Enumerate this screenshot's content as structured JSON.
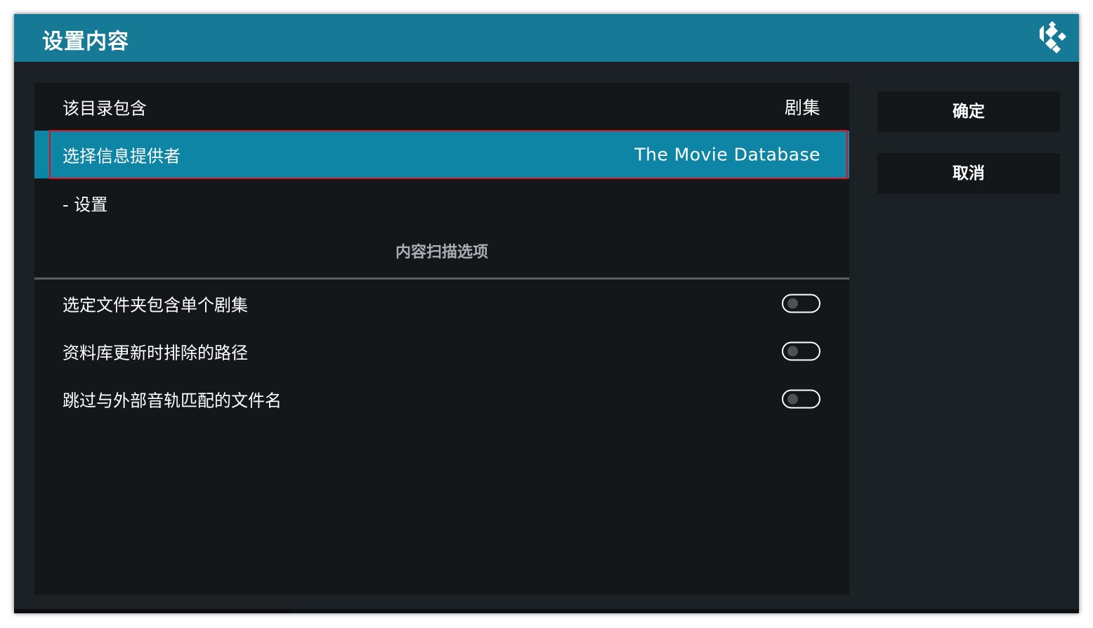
{
  "dialog": {
    "title": "设置内容"
  },
  "rows": {
    "contains": {
      "label": "该目录包含",
      "value": "剧集"
    },
    "provider": {
      "label": "选择信息提供者",
      "value": "The Movie Database"
    },
    "settings": {
      "label": "- 设置"
    }
  },
  "section": {
    "title": "内容扫描选项"
  },
  "options": [
    {
      "label": "选定文件夹包含单个剧集",
      "enabled": false
    },
    {
      "label": "资料库更新时排除的路径",
      "enabled": false
    },
    {
      "label": "跳过与外部音轨匹配的文件名",
      "enabled": false
    }
  ],
  "buttons": {
    "ok": "确定",
    "cancel": "取消"
  },
  "colors": {
    "titlebar": "#167a97",
    "selected_row": "#0f85a6",
    "focus_outline": "#e0111d",
    "panel": "#131719",
    "window": "#1b2125"
  },
  "icons": {
    "logo": "kodi-logo-icon"
  }
}
